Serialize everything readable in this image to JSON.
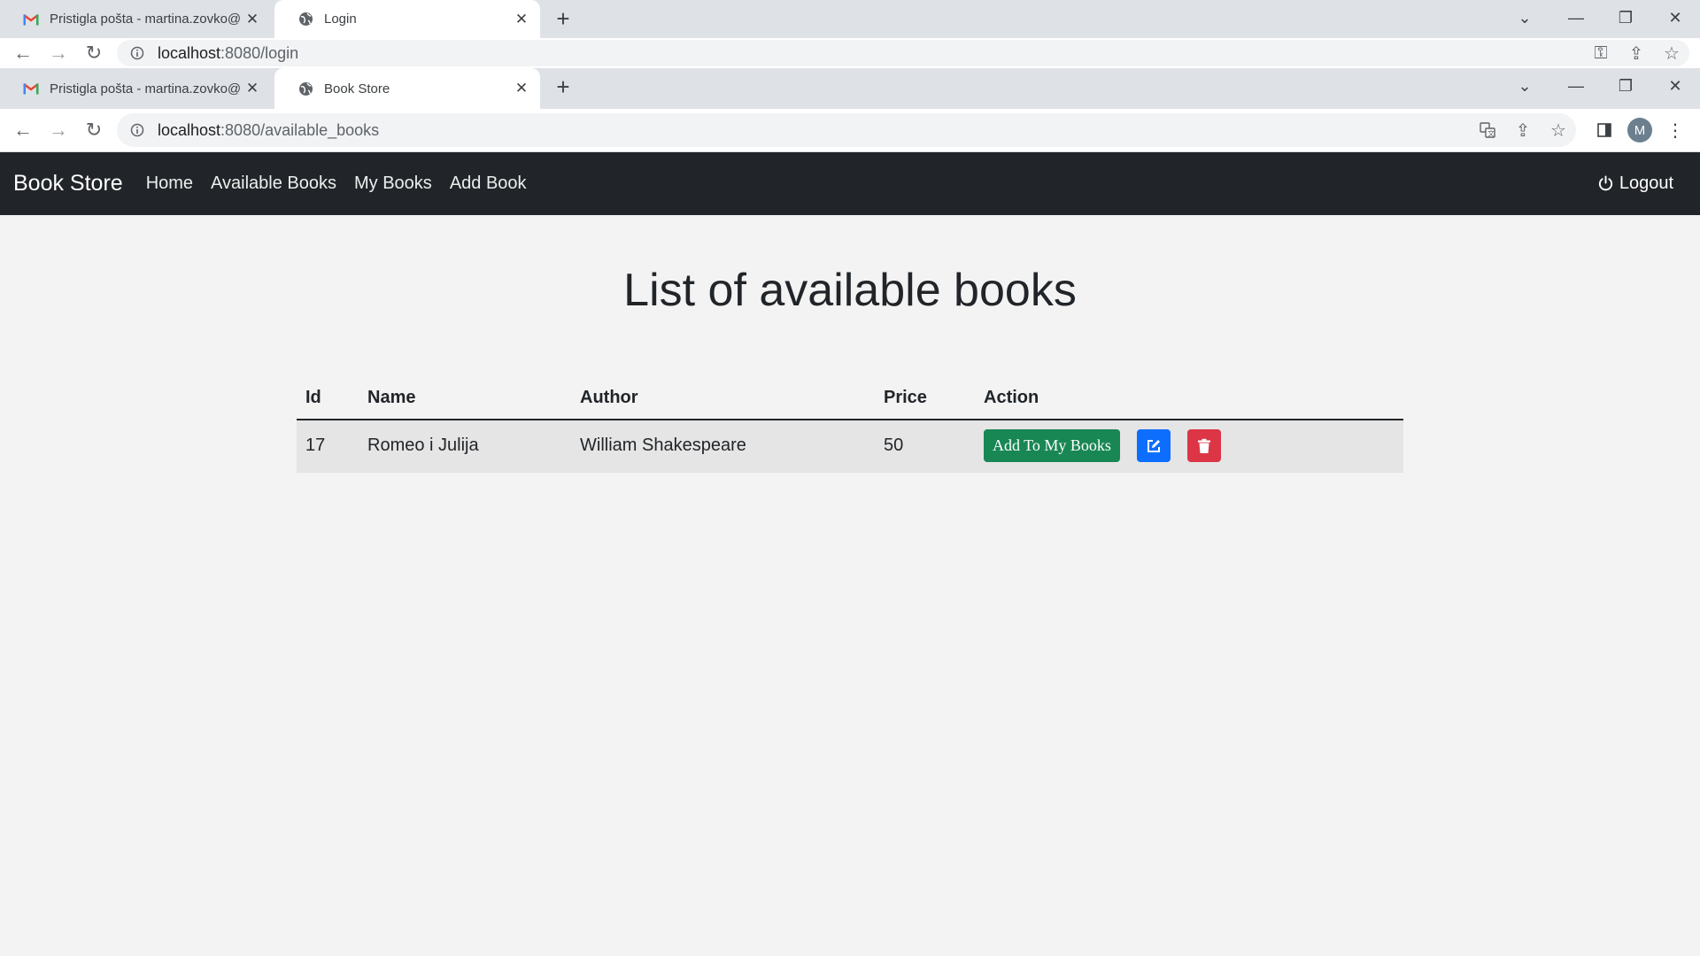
{
  "browser_back": {
    "tabs": [
      {
        "title": "Pristigla pošta - martina.zovko@"
      },
      {
        "title": "Login"
      }
    ],
    "url_host": "localhost",
    "url_path": ":8080/login"
  },
  "browser_front": {
    "tabs": [
      {
        "title": "Pristigla pošta - martina.zovko@"
      },
      {
        "title": "Book Store"
      }
    ],
    "url_host": "localhost",
    "url_path": ":8080/available_books",
    "avatar_letter": "M"
  },
  "navbar": {
    "brand": "Book Store",
    "links": [
      "Home",
      "Available Books",
      "My Books",
      "Add Book"
    ],
    "logout": "Logout"
  },
  "page": {
    "title": "List of available books"
  },
  "table": {
    "headers": [
      "Id",
      "Name",
      "Author",
      "Price",
      "Action"
    ],
    "rows": [
      {
        "id": "17",
        "name": "Romeo i Julija",
        "author": "William Shakespeare",
        "price": "50",
        "add_label": "Add To My Books"
      }
    ]
  },
  "colors": {
    "navbar_bg": "#212529",
    "btn_add": "#198754",
    "btn_edit": "#0d6efd",
    "btn_delete": "#dc3545",
    "gmail_red": "#ea4335"
  }
}
